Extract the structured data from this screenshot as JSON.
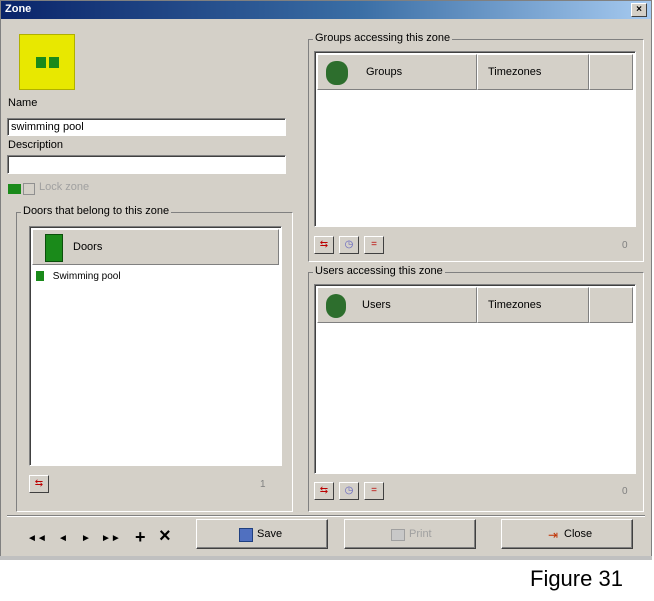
{
  "window": {
    "title": "Zone",
    "close_glyph": "×"
  },
  "form": {
    "name_label": "Name",
    "name_value": "swimming pool",
    "description_label": "Description",
    "description_value": "",
    "lock_zone_label": "Lock zone"
  },
  "doors_panel": {
    "title": "Doors that belong to this zone",
    "header": "Doors",
    "items": [
      "Swimming pool"
    ],
    "count": "1"
  },
  "groups_panel": {
    "title": "Groups accessing this zone",
    "col1": "Groups",
    "col2": "Timezones",
    "count": "0"
  },
  "users_panel": {
    "title": "Users accessing this zone",
    "col1": "Users",
    "col2": "Timezones",
    "count": "0"
  },
  "toolbar": {
    "first": "◄◄",
    "prev": "◄",
    "next": "►",
    "last": "►►",
    "add": "+",
    "delete": "×",
    "save_label": "Save",
    "print_label": "Print",
    "close_label": "Close"
  },
  "caption": "Figure 31"
}
